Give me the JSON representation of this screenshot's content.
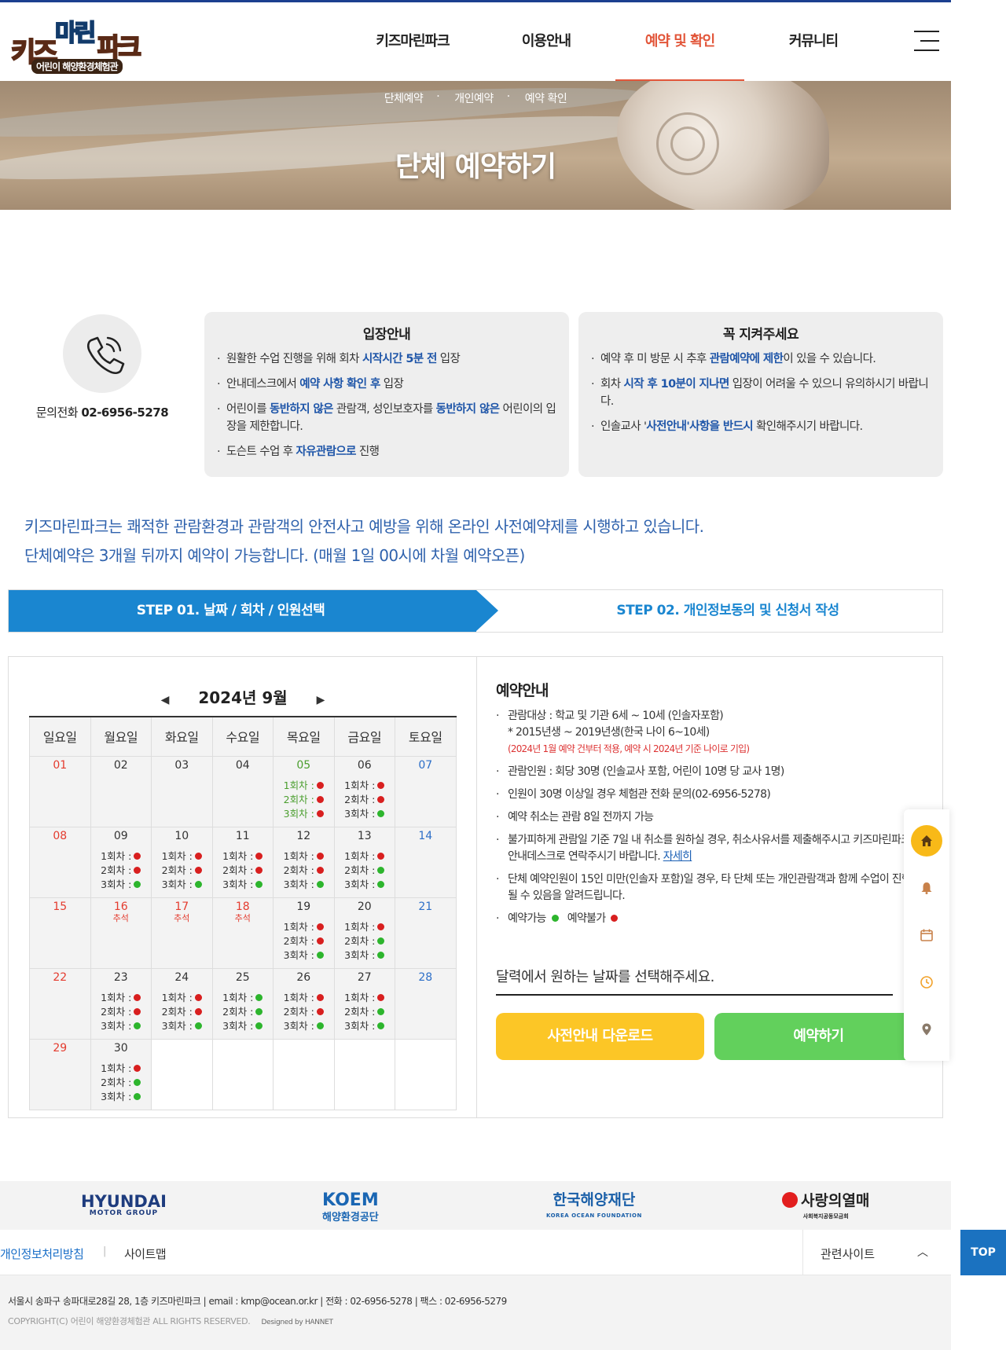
{
  "logo": {
    "kids": "키즈",
    "marine": "마린",
    "park": "파크",
    "sub": "어린이 해양환경체험관"
  },
  "nav": {
    "items": [
      {
        "label": "키즈마린파크"
      },
      {
        "label": "이용안내"
      },
      {
        "label": "예약 및 확인",
        "active": true
      },
      {
        "label": "커뮤니티"
      }
    ]
  },
  "banner": {
    "subnav": [
      "단체예약",
      "개인예약",
      "예약 확인"
    ],
    "title": "단체 예약하기"
  },
  "contact": {
    "label": "문의전화",
    "phone": "02-6956-5278"
  },
  "entry_info": {
    "title": "입장안내",
    "items": [
      {
        "pre": "원활한 수업 진행을 위해 회차 ",
        "hl": "시작시간 5분 전",
        "post": " 입장"
      },
      {
        "pre": "안내데스크에서 ",
        "hl": "예약 사항 확인 후",
        "post": " 입장"
      },
      {
        "pre": "어린이를 ",
        "hl": "동반하지 않은",
        "mid": " 관람객, 성인보호자를 ",
        "hl2": "동반하지 않은",
        "post": " 어린이의 입장을 제한합니다."
      },
      {
        "pre": "도슨트 수업 후 ",
        "hl": "자유관람으로",
        "post": " 진행"
      }
    ]
  },
  "must_keep": {
    "title": "꼭 지켜주세요",
    "items": [
      {
        "pre": "예약 후 미 방문 시 추후 ",
        "hl": "관람예약에 제한",
        "post": "이 있을 수 있습니다."
      },
      {
        "pre": "회차 ",
        "hl": "시작 후 10분이 지나면",
        "post": " 입장이 어려울 수 있으니 유의하시기 바랍니다."
      },
      {
        "pre": "인솔교사 '",
        "hl": "사전안내'사항을 반드시",
        "post": " 확인해주시기 바랍니다."
      }
    ]
  },
  "intro": {
    "line1": "키즈마린파크는 쾌적한 관람환경과 관람객의 안전사고 예방을 위해 온라인 사전예약제를 시행하고 있습니다.",
    "line2": "단체예약은 3개월 뒤까지 예약이 가능합니다. (매월 1일 00시에 차월 예약오픈)"
  },
  "steps": {
    "step1": "STEP 01. 날짜 / 회차 / 인원선택",
    "step2": "STEP 02. 개인정보동의 및 신청서 작성"
  },
  "calendar": {
    "prev": "◀",
    "next": "▶",
    "month_label": "2024년  9월",
    "weekdays": [
      "일요일",
      "월요일",
      "화요일",
      "수요일",
      "목요일",
      "금요일",
      "토요일"
    ],
    "slot_labels": [
      "1회차 :",
      "2회차 :",
      "3회차 :"
    ],
    "weeks": [
      [
        {
          "d": "01",
          "type": "sun"
        },
        {
          "d": "02",
          "type": "norm"
        },
        {
          "d": "03",
          "type": "norm"
        },
        {
          "d": "04",
          "type": "norm"
        },
        {
          "d": "05",
          "type": "green",
          "slots": [
            "r",
            "r",
            "r"
          ],
          "green_text": true
        },
        {
          "d": "06",
          "type": "norm",
          "slots": [
            "r",
            "r",
            "g"
          ]
        },
        {
          "d": "07",
          "type": "sat"
        }
      ],
      [
        {
          "d": "08",
          "type": "sun"
        },
        {
          "d": "09",
          "type": "norm",
          "slots": [
            "r",
            "r",
            "g"
          ]
        },
        {
          "d": "10",
          "type": "norm",
          "slots": [
            "r",
            "r",
            "g"
          ]
        },
        {
          "d": "11",
          "type": "norm",
          "slots": [
            "r",
            "r",
            "g"
          ]
        },
        {
          "d": "12",
          "type": "norm",
          "slots": [
            "r",
            "r",
            "g"
          ]
        },
        {
          "d": "13",
          "type": "norm",
          "slots": [
            "r",
            "g",
            "g"
          ]
        },
        {
          "d": "14",
          "type": "sat"
        }
      ],
      [
        {
          "d": "15",
          "type": "sun"
        },
        {
          "d": "16",
          "type": "hol",
          "hol": "추석"
        },
        {
          "d": "17",
          "type": "hol",
          "hol": "추석"
        },
        {
          "d": "18",
          "type": "hol",
          "hol": "추석"
        },
        {
          "d": "19",
          "type": "norm",
          "slots": [
            "r",
            "r",
            "g"
          ]
        },
        {
          "d": "20",
          "type": "norm",
          "slots": [
            "r",
            "g",
            "g"
          ]
        },
        {
          "d": "21",
          "type": "sat"
        }
      ],
      [
        {
          "d": "22",
          "type": "sun"
        },
        {
          "d": "23",
          "type": "norm",
          "slots": [
            "r",
            "r",
            "g"
          ]
        },
        {
          "d": "24",
          "type": "norm",
          "slots": [
            "r",
            "r",
            "g"
          ]
        },
        {
          "d": "25",
          "type": "norm",
          "slots": [
            "g",
            "g",
            "g"
          ]
        },
        {
          "d": "26",
          "type": "norm",
          "slots": [
            "r",
            "r",
            "g"
          ]
        },
        {
          "d": "27",
          "type": "norm",
          "slots": [
            "r",
            "g",
            "g"
          ]
        },
        {
          "d": "28",
          "type": "sat"
        }
      ],
      [
        {
          "d": "29",
          "type": "sun"
        },
        {
          "d": "30",
          "type": "norm",
          "slots": [
            "r",
            "g",
            "g"
          ]
        },
        {
          "empty": true
        },
        {
          "empty": true
        },
        {
          "empty": true
        },
        {
          "empty": true
        },
        {
          "empty": true
        }
      ]
    ]
  },
  "guide": {
    "title": "예약안내",
    "target": "관람대상 : 학교 및 기관 6세 ~ 10세 (인솔자포함)",
    "target2": "* 2015년생 ~ 2019년생(한국 나이 6~10세)",
    "target_note": "(2024년 1월 예약 건부터 적용, 예약 시 2024년 기준 나이로 기입)",
    "capacity": "관람인원 : 회당 30명 (인솔교사 포함, 어린이 10명 당 교사 1명)",
    "over30": "인원이 30명 이상일 경우 체험관 전화 문의(02-6956-5278)",
    "cancel": "예약 취소는 관람 8일 전까지 가능",
    "unavoidable": "불가피하게 관람일 기준 7일 내 취소를 원하실 경우, 취소사유서를 제출해주시고 키즈마린파크 안내데스크로 연락주시기 바랍니다.",
    "detail_link": "자세히",
    "under15": "단체 예약인원이 15인 미만(인솔자 포함)일 경우, 타 단체 또는 개인관람객과 함께 수업이 진행될 수 있음을 알려드립니다.",
    "legend_ok": "예약가능",
    "legend_no": "예약불가"
  },
  "select_msg": "달력에서 원하는 날짜를 선택해주세요.",
  "buttons": {
    "download": "사전안내 다운로드",
    "reserve": "예약하기"
  },
  "quick": [
    "home-icon",
    "bell-icon",
    "calendar-icon",
    "clock-icon",
    "location-icon"
  ],
  "sponsors": {
    "hyundai": "HYUNDAI",
    "hyundai_sub": "MOTOR GROUP",
    "koem": "KOEM",
    "koem_sub": "해양환경공단",
    "kof": "한국해양재단",
    "kof_sub": "KOREA OCEAN FOUNDATION",
    "love": "사랑의열매",
    "love_sub": "사회복지공동모금회"
  },
  "footer": {
    "privacy": "개인정보처리방침",
    "sep": "|",
    "sitemap": "사이트맵",
    "related": "관련사이트",
    "related_chev": "︿",
    "top": "TOP",
    "address": "서울시 송파구 송파대로28길 28, 1층 키즈마린파크   |   email : kmp@ocean.or.kr   |   전화 : 02-6956-5278   |   팩스 : 02-6956-5279",
    "copyright": "COPYRIGHT(C) 어린이 해양환경체험관 ALL RIGHTS RESERVED.",
    "designed": "Designed by HANNET"
  },
  "colors": {
    "accent": "#e2563a",
    "step_blue": "#1a86d0",
    "btn_yellow": "#fcc626",
    "btn_green": "#62d05c",
    "dot_red": "#d81f1f",
    "dot_green": "#2db52d"
  }
}
